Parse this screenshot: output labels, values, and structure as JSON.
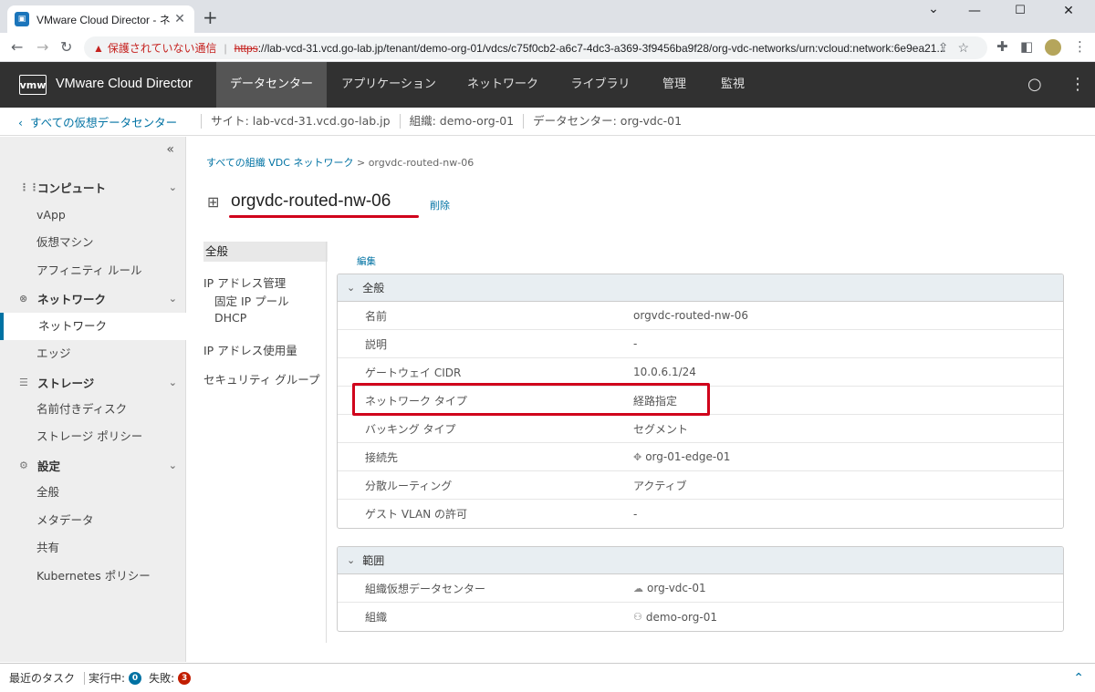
{
  "browser": {
    "tab_title": "VMware Cloud Director - ネットワ",
    "security_warning": "保護されていない通信",
    "url_scheme": "https",
    "url_rest": "://lab-vcd-31.vcd.go-lab.jp/tenant/demo-org-01/vdcs/c75f0cb2-a6c7-4dc3-a369-3f9456ba9f28/org-vdc-networks/urn:vcloud:network:6e9ea21..."
  },
  "header": {
    "logo": "vmw",
    "brand": "VMware Cloud Director",
    "tabs": [
      "データセンター",
      "アプリケーション",
      "ネットワーク",
      "ライブラリ",
      "管理",
      "監視"
    ]
  },
  "context": {
    "back": "すべての仮想データセンター",
    "site": "サイト: lab-vcd-31.vcd.go-lab.jp",
    "org": "組織: demo-org-01",
    "datacenter": "データセンター: org-vdc-01"
  },
  "sidebar": {
    "collapse": "«",
    "compute": "コンピュート",
    "vapp": "vApp",
    "vm": "仮想マシン",
    "affinity": "アフィニティ ルール",
    "network_group": "ネットワーク",
    "network": "ネットワーク",
    "edge": "エッジ",
    "storage": "ストレージ",
    "named_disk": "名前付きディスク",
    "storage_policy": "ストレージ ポリシー",
    "settings": "設定",
    "general": "全般",
    "metadata": "メタデータ",
    "sharing": "共有",
    "k8s": "Kubernetes ポリシー"
  },
  "main": {
    "crumb_link": "すべての組織 VDC ネットワーク",
    "crumb_sep": ">",
    "crumb_current": "orgvdc-routed-nw-06",
    "title": "orgvdc-routed-nw-06",
    "delete": "削除",
    "edit": "編集",
    "lnav": {
      "general": "全般",
      "ip_mgmt": "IP アドレス管理",
      "static_pool": "固定 IP プール",
      "dhcp": "DHCP",
      "ip_usage": "IP アドレス使用量",
      "security_group": "セキュリティ グループ"
    },
    "general_card": {
      "title": "全般",
      "rows": [
        {
          "k": "名前",
          "v": "orgvdc-routed-nw-06"
        },
        {
          "k": "説明",
          "v": "-"
        },
        {
          "k": "ゲートウェイ CIDR",
          "v": "10.0.6.1/24"
        },
        {
          "k": "ネットワーク タイプ",
          "v": "経路指定"
        },
        {
          "k": "バッキング タイプ",
          "v": "セグメント"
        },
        {
          "k": "接続先",
          "v": "org-01-edge-01"
        },
        {
          "k": "分散ルーティング",
          "v": "アクティブ"
        },
        {
          "k": "ゲスト VLAN の許可",
          "v": "-"
        }
      ]
    },
    "scope_card": {
      "title": "範囲",
      "rows": [
        {
          "k": "組織仮想データセンター",
          "v": "org-vdc-01"
        },
        {
          "k": "組織",
          "v": "demo-org-01"
        }
      ]
    }
  },
  "status": {
    "recent_tasks": "最近のタスク",
    "running_label": "実行中:",
    "running_count": "0",
    "failed_label": "失敗:",
    "failed_count": "3"
  },
  "colors": {
    "accent": "#0072a3",
    "header_bg": "#313131",
    "highlight_red": "#d0021b"
  }
}
